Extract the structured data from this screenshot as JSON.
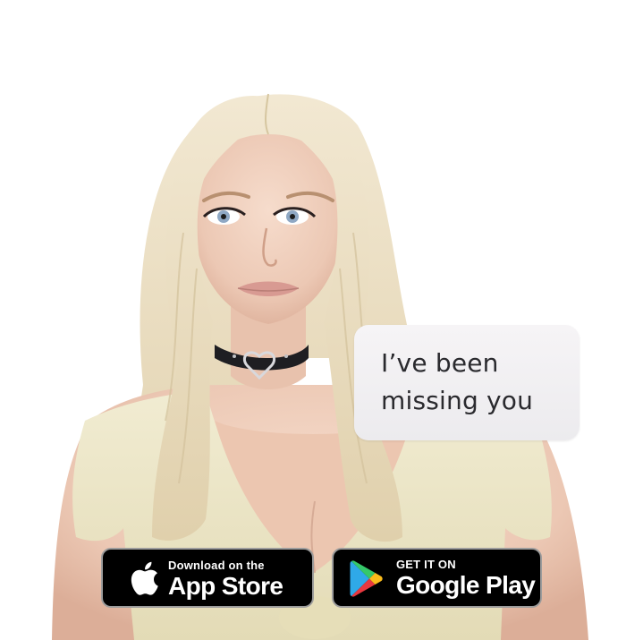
{
  "chat": {
    "message": "I’ve been\nmissing you"
  },
  "badges": {
    "apple": {
      "small": "Download on the",
      "big": "App Store",
      "icon": "apple-logo-icon"
    },
    "google": {
      "small": "GET IT ON",
      "big": "Google Play",
      "icon": "google-play-logo-icon"
    }
  },
  "colors": {
    "background": "#ffffff",
    "bubble": "#efedf0",
    "bubble_text": "#2a2a2e",
    "hair": "#e8dcc0",
    "skin": "#f0d2c0",
    "top": "#ece6c6",
    "badge_bg": "#000000",
    "badge_border": "#9c9c9c"
  }
}
